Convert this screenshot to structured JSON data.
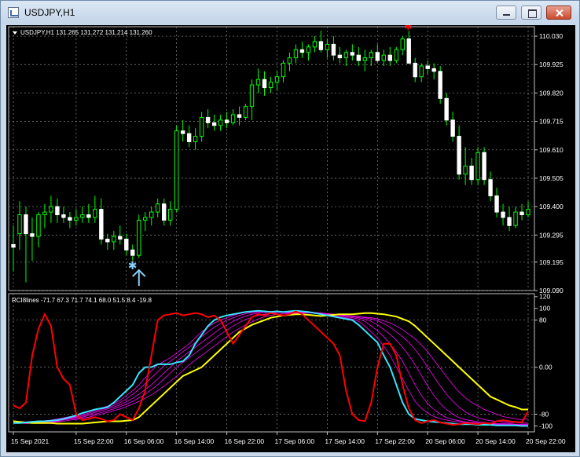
{
  "window": {
    "title": "USDJPY,H1"
  },
  "main_chart": {
    "header": "USDJPY,H1  131.265 131.272 131.214 131.260",
    "y_min": 109.09,
    "y_max": 110.065,
    "price_ticks": [
      "110.030",
      "109.925",
      "109.820",
      "109.715",
      "109.610",
      "109.505",
      "109.400",
      "109.295",
      "109.195",
      "109.090"
    ],
    "price_tick_values": [
      110.03,
      109.925,
      109.82,
      109.715,
      109.61,
      109.505,
      109.4,
      109.295,
      109.195,
      109.09
    ],
    "candle_color": "#00ff00",
    "buy_signal_color": "#87cefa",
    "sell_signal_color": "#ff0000",
    "buy_signal_index": 19,
    "sell_signal_index": 63,
    "candles": [
      [
        109.26,
        109.33,
        109.16,
        109.25
      ],
      [
        109.3,
        109.42,
        109.24,
        109.37
      ],
      [
        109.37,
        109.4,
        109.12,
        109.3
      ],
      [
        109.3,
        109.36,
        109.2,
        109.29
      ],
      [
        109.29,
        109.38,
        109.25,
        109.37
      ],
      [
        109.37,
        109.41,
        109.32,
        109.38
      ],
      [
        109.38,
        109.44,
        109.34,
        109.4
      ],
      [
        109.4,
        109.43,
        109.34,
        109.37
      ],
      [
        109.37,
        109.4,
        109.34,
        109.36
      ],
      [
        109.36,
        109.38,
        109.32,
        109.35
      ],
      [
        109.35,
        109.39,
        109.33,
        109.36
      ],
      [
        109.36,
        109.4,
        109.34,
        109.37
      ],
      [
        109.37,
        109.41,
        109.34,
        109.36
      ],
      [
        109.36,
        109.44,
        109.34,
        109.39
      ],
      [
        109.39,
        109.43,
        109.26,
        109.28
      ],
      [
        109.28,
        109.3,
        109.24,
        109.27
      ],
      [
        109.27,
        109.31,
        109.24,
        109.29
      ],
      [
        109.29,
        109.33,
        109.26,
        109.28
      ],
      [
        109.28,
        109.3,
        109.22,
        109.24
      ],
      [
        109.24,
        109.26,
        109.2,
        109.22
      ],
      [
        109.22,
        109.37,
        109.21,
        109.35
      ],
      [
        109.35,
        109.38,
        109.31,
        109.36
      ],
      [
        109.36,
        109.4,
        109.33,
        109.38
      ],
      [
        109.38,
        109.43,
        109.36,
        109.41
      ],
      [
        109.41,
        109.43,
        109.33,
        109.35
      ],
      [
        109.35,
        109.42,
        109.33,
        109.39
      ],
      [
        109.39,
        109.7,
        109.38,
        109.68
      ],
      [
        109.68,
        109.72,
        109.64,
        109.67
      ],
      [
        109.67,
        109.7,
        109.62,
        109.64
      ],
      [
        109.64,
        109.69,
        109.61,
        109.66
      ],
      [
        109.66,
        109.75,
        109.64,
        109.73
      ],
      [
        109.73,
        109.76,
        109.69,
        109.71
      ],
      [
        109.71,
        109.74,
        109.68,
        109.7
      ],
      [
        109.7,
        109.74,
        109.68,
        109.72
      ],
      [
        109.72,
        109.75,
        109.69,
        109.71
      ],
      [
        109.71,
        109.76,
        109.7,
        109.74
      ],
      [
        109.74,
        109.77,
        109.7,
        109.73
      ],
      [
        109.73,
        109.78,
        109.72,
        109.77
      ],
      [
        109.77,
        109.87,
        109.72,
        109.85
      ],
      [
        109.85,
        109.91,
        109.82,
        109.87
      ],
      [
        109.87,
        109.9,
        109.81,
        109.84
      ],
      [
        109.84,
        109.88,
        109.82,
        109.86
      ],
      [
        109.86,
        109.9,
        109.83,
        109.88
      ],
      [
        109.88,
        109.94,
        109.86,
        109.93
      ],
      [
        109.93,
        109.97,
        109.9,
        109.95
      ],
      [
        109.95,
        110.0,
        109.93,
        109.98
      ],
      [
        109.98,
        110.01,
        109.95,
        109.97
      ],
      [
        109.97,
        110.0,
        109.94,
        109.99
      ],
      [
        109.99,
        110.03,
        109.97,
        110.01
      ],
      [
        110.01,
        110.05,
        109.97,
        109.98
      ],
      [
        109.98,
        110.02,
        109.95,
        110.0
      ],
      [
        110.0,
        110.03,
        109.94,
        109.96
      ],
      [
        109.96,
        109.99,
        109.93,
        109.95
      ],
      [
        109.95,
        109.98,
        109.92,
        109.97
      ],
      [
        109.97,
        110.0,
        109.94,
        109.96
      ],
      [
        109.96,
        109.99,
        109.92,
        109.94
      ],
      [
        109.94,
        109.98,
        109.9,
        109.95
      ],
      [
        109.95,
        109.98,
        109.92,
        109.97
      ],
      [
        109.97,
        110.0,
        109.93,
        109.94
      ],
      [
        109.94,
        109.98,
        109.92,
        109.96
      ],
      [
        109.96,
        109.99,
        109.92,
        109.94
      ],
      [
        109.94,
        109.99,
        109.93,
        109.98
      ],
      [
        109.98,
        110.03,
        109.96,
        110.02
      ],
      [
        110.02,
        110.05,
        109.93,
        109.93
      ],
      [
        109.93,
        109.95,
        109.86,
        109.88
      ],
      [
        109.88,
        109.93,
        109.86,
        109.92
      ],
      [
        109.92,
        109.94,
        109.89,
        109.91
      ],
      [
        109.91,
        109.93,
        109.87,
        109.9
      ],
      [
        109.9,
        109.92,
        109.78,
        109.8
      ],
      [
        109.8,
        109.82,
        109.7,
        109.72
      ],
      [
        109.72,
        109.75,
        109.64,
        109.66
      ],
      [
        109.66,
        109.7,
        109.5,
        109.52
      ],
      [
        109.52,
        109.62,
        109.48,
        109.55
      ],
      [
        109.55,
        109.58,
        109.48,
        109.5
      ],
      [
        109.5,
        109.62,
        109.48,
        109.6
      ],
      [
        109.6,
        109.62,
        109.48,
        109.5
      ],
      [
        109.5,
        109.53,
        109.42,
        109.44
      ],
      [
        109.44,
        109.47,
        109.36,
        109.38
      ],
      [
        109.38,
        109.41,
        109.33,
        109.36
      ],
      [
        109.36,
        109.4,
        109.31,
        109.33
      ],
      [
        109.33,
        109.4,
        109.32,
        109.38
      ],
      [
        109.38,
        109.41,
        109.35,
        109.37
      ],
      [
        109.37,
        109.42,
        109.36,
        109.39
      ]
    ]
  },
  "rci_panel": {
    "header": "RCI8lines -71.7 67.3 71.7 74.1 68.0 51.5 8.4 -19.8",
    "y_ticks": [
      "120",
      "100",
      "80",
      "0.00",
      "-80",
      "-100"
    ],
    "y_tick_values": [
      120,
      100,
      80,
      0,
      -80,
      -100
    ],
    "y_min": -110,
    "y_max": 125,
    "colors": {
      "fast": "#ff0000",
      "cyan": "#33e6ff",
      "magenta": "#ff00ff",
      "slow": "#ffff00"
    },
    "fast_line": [
      -65,
      -70,
      -60,
      20,
      65,
      90,
      70,
      0,
      -20,
      -30,
      -80,
      -90,
      -88,
      -85,
      -88,
      -92,
      -90,
      -80,
      -85,
      -90,
      -70,
      -40,
      20,
      80,
      88,
      90,
      92,
      88,
      90,
      92,
      90,
      85,
      88,
      80,
      60,
      40,
      55,
      70,
      85,
      90,
      88,
      92,
      90,
      88,
      90,
      95,
      90,
      80,
      70,
      60,
      50,
      40,
      20,
      -40,
      -80,
      -90,
      -92,
      -60,
      0,
      40,
      40,
      20,
      -30,
      -70,
      -90,
      -95,
      -92,
      -90,
      -94,
      -96,
      -98,
      -97,
      -95,
      -96,
      -97,
      -95,
      -96,
      -92,
      -90,
      -92,
      -93,
      -94,
      -75
    ],
    "cyan_line": [
      -95,
      -95,
      -94,
      -93,
      -92,
      -92,
      -91,
      -90,
      -88,
      -85,
      -82,
      -78,
      -75,
      -72,
      -70,
      -68,
      -60,
      -50,
      -40,
      -30,
      -10,
      0,
      0,
      5,
      5,
      5,
      8,
      10,
      20,
      40,
      55,
      70,
      80,
      85,
      88,
      90,
      92,
      94,
      95,
      96,
      95,
      94,
      95,
      94,
      95,
      96,
      95,
      94,
      92,
      90,
      88,
      86,
      84,
      82,
      80,
      72,
      62,
      52,
      42,
      20,
      0,
      -30,
      -60,
      -80,
      -88,
      -90,
      -92,
      -93,
      -94,
      -95,
      -96,
      -97,
      -97,
      -97,
      -98,
      -98,
      -98,
      -99,
      -99,
      -99,
      -99,
      -100,
      -100
    ],
    "yellow_line": [
      -92,
      -93,
      -94,
      -95,
      -95,
      -95,
      -95,
      -96,
      -96,
      -96,
      -96,
      -96,
      -95,
      -94,
      -93,
      -92,
      -92,
      -92,
      -91,
      -90,
      -85,
      -75,
      -65,
      -55,
      -45,
      -35,
      -25,
      -15,
      -10,
      -5,
      0,
      10,
      20,
      30,
      40,
      50,
      60,
      66,
      72,
      76,
      80,
      84,
      86,
      88,
      89,
      90,
      90,
      89,
      88,
      87,
      88,
      89,
      90,
      90,
      90,
      91,
      92,
      92,
      91,
      90,
      88,
      86,
      82,
      78,
      70,
      60,
      50,
      40,
      30,
      20,
      10,
      0,
      -10,
      -20,
      -30,
      -40,
      -50,
      -55,
      -60,
      -65,
      -68,
      -72,
      -72
    ],
    "magenta_lines": [
      [
        -93,
        -94,
        -93,
        -92,
        -92,
        -91,
        -90,
        -88,
        -86,
        -84,
        -82,
        -79,
        -76,
        -73,
        -70,
        -66,
        -62,
        -56,
        -48,
        -40,
        -30,
        -18,
        -6,
        4,
        10,
        16,
        24,
        32,
        40,
        50,
        60,
        68,
        75,
        80,
        84,
        88,
        91,
        93,
        94,
        95,
        95,
        95,
        94,
        94,
        94,
        95,
        95,
        94,
        93,
        92,
        90,
        88,
        86,
        84,
        82,
        78,
        70,
        60,
        50,
        36,
        20,
        0,
        -20,
        -40,
        -58,
        -70,
        -78,
        -84,
        -88,
        -90,
        -92,
        -93,
        -94,
        -95,
        -96,
        -96,
        -97,
        -97,
        -98,
        -98,
        -98,
        -99,
        -99
      ],
      [
        -94,
        -95,
        -94,
        -93,
        -93,
        -92,
        -91,
        -90,
        -88,
        -86,
        -84,
        -81,
        -78,
        -75,
        -72,
        -69,
        -65,
        -60,
        -54,
        -46,
        -38,
        -28,
        -18,
        -8,
        2,
        10,
        18,
        26,
        34,
        42,
        52,
        60,
        68,
        74,
        80,
        84,
        88,
        91,
        93,
        94,
        95,
        95,
        94,
        94,
        93,
        94,
        95,
        94,
        93,
        92,
        91,
        90,
        88,
        86,
        84,
        82,
        78,
        70,
        62,
        52,
        40,
        26,
        10,
        -10,
        -30,
        -48,
        -62,
        -72,
        -80,
        -86,
        -89,
        -91,
        -93,
        -94,
        -95,
        -96,
        -96,
        -97,
        -97,
        -97,
        -98,
        -98,
        -98
      ],
      [
        -94,
        -95,
        -95,
        -94,
        -94,
        -93,
        -92,
        -91,
        -89,
        -87,
        -85,
        -83,
        -80,
        -77,
        -74,
        -71,
        -68,
        -64,
        -59,
        -53,
        -46,
        -38,
        -30,
        -20,
        -10,
        0,
        10,
        18,
        26,
        34,
        42,
        50,
        58,
        66,
        72,
        78,
        83,
        87,
        90,
        92,
        93,
        94,
        94,
        93,
        93,
        93,
        94,
        94,
        93,
        92,
        91,
        90,
        89,
        88,
        86,
        84,
        82,
        78,
        72,
        64,
        56,
        46,
        34,
        20,
        4,
        -14,
        -32,
        -48,
        -62,
        -72,
        -80,
        -86,
        -89,
        -91,
        -93,
        -94,
        -95,
        -96,
        -96,
        -96,
        -97,
        -97,
        -97
      ],
      [
        -95,
        -95,
        -95,
        -95,
        -94,
        -94,
        -93,
        -92,
        -90,
        -88,
        -87,
        -85,
        -82,
        -80,
        -77,
        -74,
        -71,
        -67,
        -63,
        -58,
        -52,
        -46,
        -38,
        -30,
        -20,
        -10,
        0,
        8,
        16,
        24,
        32,
        40,
        48,
        56,
        63,
        70,
        76,
        81,
        85,
        88,
        90,
        92,
        93,
        93,
        92,
        92,
        93,
        93,
        93,
        92,
        91,
        90,
        89,
        88,
        87,
        86,
        84,
        82,
        79,
        74,
        68,
        60,
        52,
        42,
        30,
        16,
        0,
        -16,
        -32,
        -46,
        -58,
        -68,
        -76,
        -82,
        -86,
        -89,
        -91,
        -92,
        -93,
        -94,
        -94,
        -95,
        -95
      ],
      [
        -95,
        -95,
        -96,
        -95,
        -95,
        -95,
        -94,
        -93,
        -92,
        -90,
        -89,
        -87,
        -85,
        -82,
        -80,
        -77,
        -74,
        -71,
        -67,
        -63,
        -58,
        -53,
        -47,
        -40,
        -32,
        -24,
        -15,
        -6,
        4,
        12,
        20,
        28,
        36,
        44,
        52,
        60,
        66,
        72,
        77,
        82,
        86,
        88,
        90,
        91,
        91,
        91,
        92,
        92,
        92,
        91,
        91,
        90,
        89,
        88,
        87,
        86,
        85,
        84,
        82,
        79,
        75,
        70,
        64,
        56,
        48,
        38,
        26,
        12,
        -2,
        -16,
        -30,
        -42,
        -52,
        -60,
        -66,
        -72,
        -76,
        -80,
        -84,
        -86,
        -88,
        -89,
        -88
      ]
    ]
  },
  "time_axis": {
    "labels": [
      "15 Sep 2021",
      "15 Sep 22:00",
      "16 Sep 06:00",
      "16 Sep 14:00",
      "16 Sep 22:00",
      "17 Sep 06:00",
      "17 Sep 14:00",
      "17 Sep 22:00",
      "20 Sep 06:00",
      "20 Sep 14:00",
      "20 Sep 22:00"
    ],
    "label_bar_index": [
      0,
      10,
      18,
      26,
      34,
      42,
      50,
      58,
      66,
      74,
      82
    ]
  }
}
